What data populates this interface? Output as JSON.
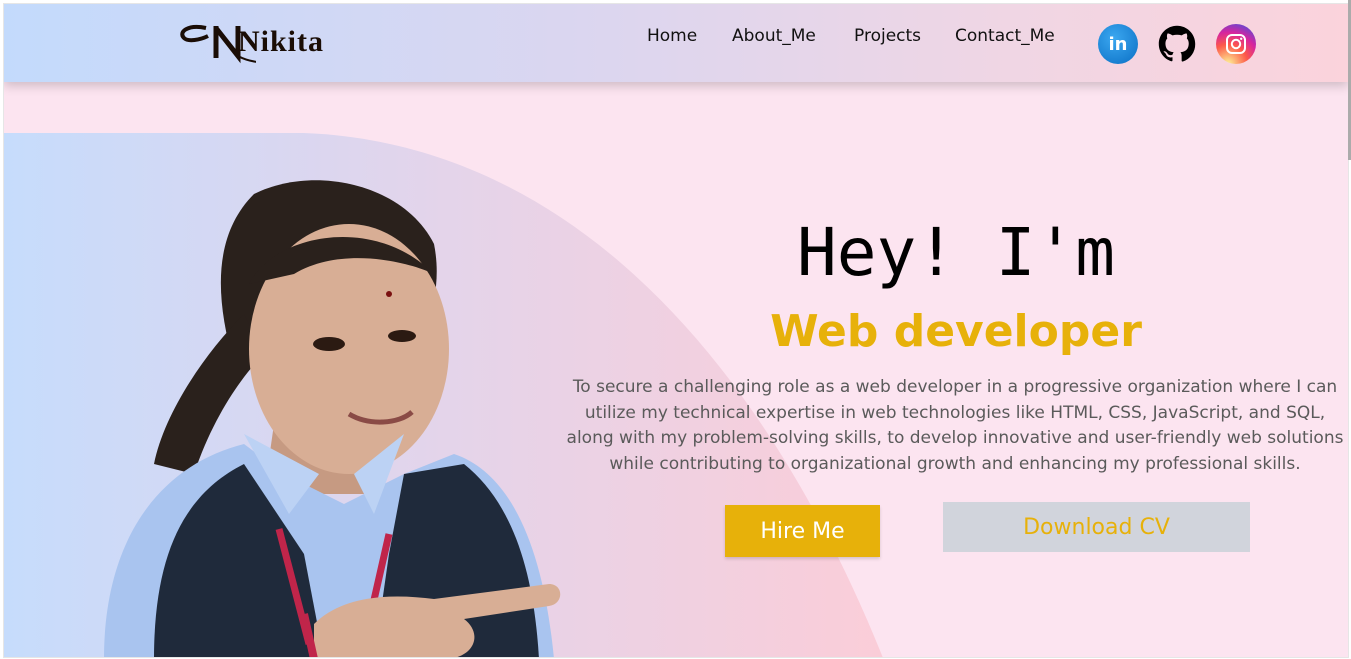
{
  "header": {
    "logo_text": "Nikita",
    "nav": [
      {
        "label": "Home"
      },
      {
        "label": "About_Me"
      },
      {
        "label": "Projects"
      },
      {
        "label": "Contact_Me"
      }
    ],
    "social": [
      {
        "name": "linkedin-icon",
        "glyph": "in",
        "color": "#0a84d6"
      },
      {
        "name": "github-icon",
        "color": "#000000"
      },
      {
        "name": "instagram-icon",
        "color": "#d6249f"
      }
    ]
  },
  "hero": {
    "greeting": "Hey! I'm",
    "role": "Web developer",
    "description": "To secure a challenging role as a web developer in a progressive organization where I can utilize my technical expertise in web technologies like HTML, CSS, JavaScript, and SQL, along with my problem-solving skills, to develop innovative and user-friendly web solutions while contributing to organizational growth and enhancing my professional skills.",
    "hire_label": "Hire Me",
    "cv_label": "Download CV"
  },
  "colors": {
    "accent": "#e7b10a",
    "background": "#fce4f0",
    "cv_button_bg": "#d1d4dc"
  }
}
